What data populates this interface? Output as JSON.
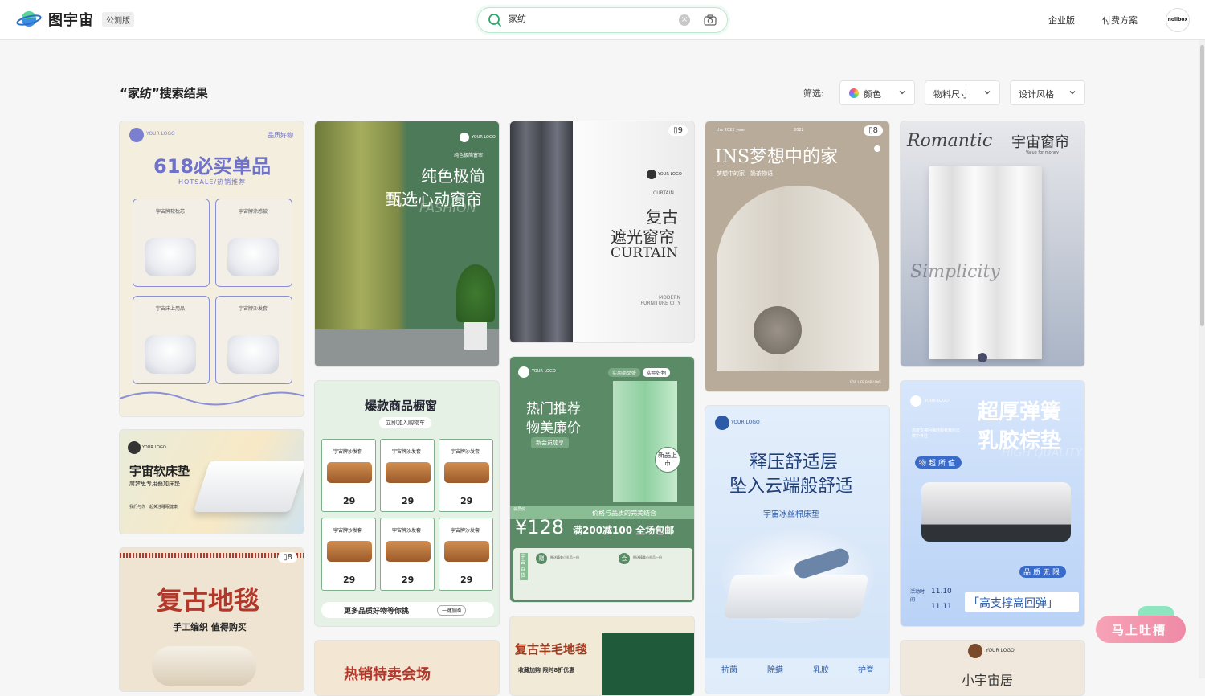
{
  "header": {
    "logo_text": "图宇宙",
    "beta_badge": "公测版",
    "search_value": "家纺",
    "links": [
      "企业版",
      "付费方案"
    ],
    "avatar_text": "nolibox"
  },
  "results": {
    "title": "“家纺”搜索结果",
    "filter_label": "筛选:",
    "filters": [
      "颜色",
      "物料尺寸",
      "设计风格"
    ]
  },
  "cards": {
    "c1": {
      "title": "618必买单品",
      "tag": "品质好物",
      "sub": "HOTSALE/热销推荐",
      "logo": "YOUR LOGO",
      "items": [
        "宇宙牌软枕芯",
        "宇宙牌涂感被",
        "宇宙床上用品",
        "宇宙牌沙发套"
      ]
    },
    "c2": {
      "logo": "YOUR LOGO",
      "line1": "纯色极简",
      "line2": "甄选心动窗帘",
      "script": "FASHION",
      "small": "纯色极简窗帘"
    },
    "c3": {
      "badge": "9",
      "logo": "YOUR LOGO",
      "tag": "CURTAIN",
      "line1": "复古",
      "line2": "遮光窗帘",
      "line3": "CURTAIN",
      "foot": "MODERN FURNITURE CITY"
    },
    "c4": {
      "badge": "8",
      "top_left": "the 2022 year",
      "top_mid": "2022",
      "title": "INS梦想中的家",
      "sub": "梦想中的家—奶茶物语",
      "foot_right": "FOR LIFE FOR LOVE"
    },
    "c5": {
      "script": "Romantic",
      "title": "宇宙窗帘",
      "sub": "Value for money",
      "script2": "Simplicity"
    },
    "c6": {
      "logo": "YOUR LOGO",
      "title": "宇宙软床垫",
      "sub": "席梦思专用叠加床垫",
      "foot": "我们与你一起关注睡眠健康"
    },
    "c7": {
      "title": "爆款商品橱窗",
      "btn": "立即加入购物车",
      "cell_label": "宇宙牌沙发套",
      "price": "29",
      "foot": "更多品质好物等你挑",
      "foot_btn": "一键加购"
    },
    "c8": {
      "logo": "YOUR LOGO",
      "tabs": [
        "实用商品盛",
        "实用好物"
      ],
      "line1": "热门推荐",
      "line2": "物美廉价",
      "pill": "新会员加享",
      "new": "新品上市",
      "banner": "价格与品质的完美结合",
      "price_label": "会员价",
      "price": "¥128",
      "promo": "满200减100 全场包邮",
      "gift1": "赠",
      "gift2": "会",
      "gift_text": "赠送精美小礼品一份",
      "side": "宇宙百货"
    },
    "c9": {
      "badge": "8",
      "title": "复古地毯",
      "sub": "手工编织 值得购买"
    },
    "c10": {
      "logo": "YOUR LOGO",
      "line1": "释压舒适层",
      "line2": "坠入云端般舒适",
      "sub": "宇宙冰丝棉床垫",
      "tags": [
        "抗菌",
        "除螨",
        "乳胶",
        "护脊"
      ]
    },
    "c11": {
      "logo": "YOUR LOGO",
      "line1": "超厚弹簧",
      "line2": "乳胶棕垫",
      "script": "HIGH QUALITY",
      "tag": "物超所值",
      "side": "高度支撑回弹舒服有效的支撑护脊柱",
      "quality": "品质无限",
      "date_label": "活动时间",
      "date1": "11.10",
      "date2": "11.11",
      "slogan": "「高支撑高回弹」"
    },
    "c12": {
      "title": "热销特卖会场"
    },
    "c13": {
      "title": "复古羊毛地毯",
      "sub": "收藏加购 限时8折优惠"
    },
    "c14": {
      "logo": "YOUR LOGO",
      "title": "小宇宙居"
    }
  },
  "feedback": {
    "label": "马上吐槽"
  },
  "colors": {
    "accent": "#2aa868",
    "purple": "#6f72c9",
    "green": "#4a8a5c"
  }
}
